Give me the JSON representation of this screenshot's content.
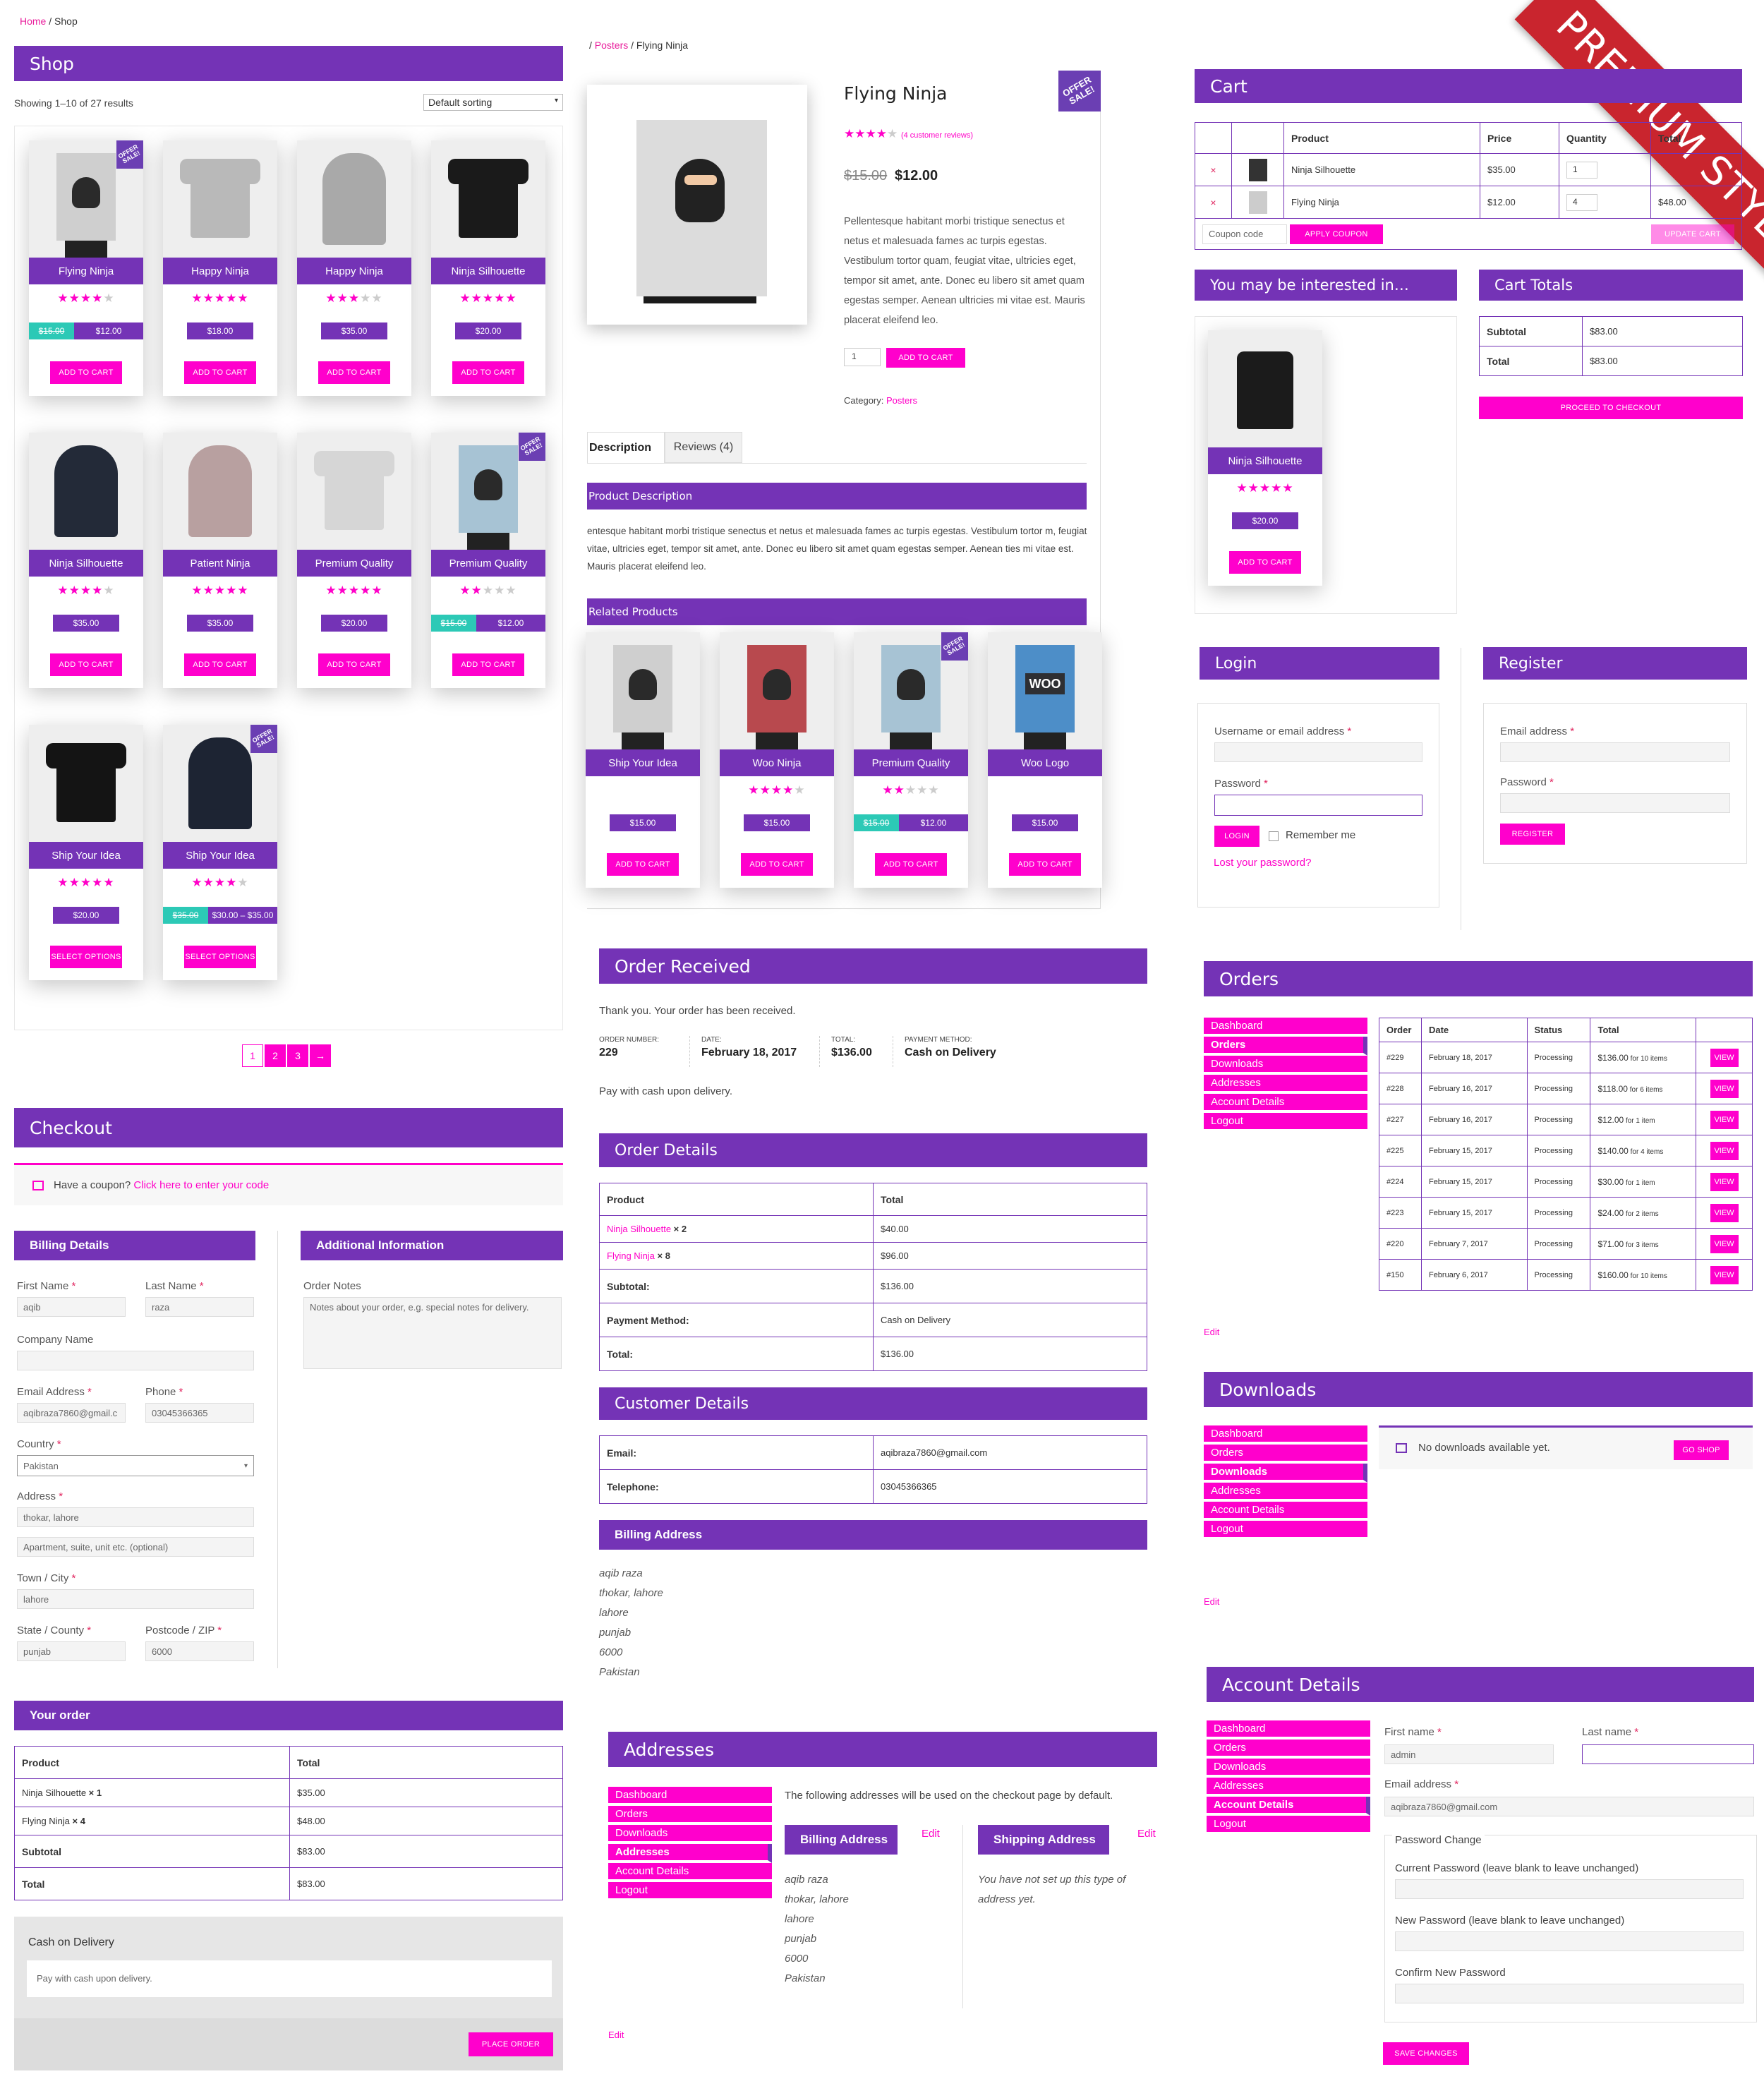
{
  "shop": {
    "breadcrumb": {
      "home": "Home",
      "sep": " / ",
      "current": "Shop"
    },
    "title": "Shop",
    "result_count": "Showing 1–10 of 27 results",
    "sorting": "Default sorting",
    "badge": "OFFER SALE!",
    "products": [
      {
        "name": "Flying Ninja",
        "rating": 4,
        "old_price": "$15.00",
        "price": "$12.00",
        "button": "ADD TO CART",
        "image": "poster-ninja",
        "sale": true
      },
      {
        "name": "Happy Ninja",
        "rating": 5,
        "price": "$18.00",
        "button": "ADD TO CART",
        "image": "tshirt-grey"
      },
      {
        "name": "Happy Ninja",
        "rating": 3,
        "price": "$35.00",
        "button": "ADD TO CART",
        "image": "hoodie-grey"
      },
      {
        "name": "Ninja Silhouette",
        "rating": 5,
        "price": "$20.00",
        "button": "ADD TO CART",
        "image": "tshirt-black"
      },
      {
        "name": "Ninja Silhouette",
        "rating": 4,
        "price": "$35.00",
        "button": "ADD TO CART",
        "image": "hoodie-black"
      },
      {
        "name": "Patient Ninja",
        "rating": 5,
        "price": "$35.00",
        "button": "ADD TO CART",
        "image": "hoodie-pink"
      },
      {
        "name": "Premium Quality",
        "rating": 5,
        "price": "$20.00",
        "button": "ADD TO CART",
        "image": "tshirt-white"
      },
      {
        "name": "Premium Quality",
        "rating": 2,
        "old_price": "$15.00",
        "price": "$12.00",
        "button": "ADD TO CART",
        "image": "poster-blue",
        "sale": true
      },
      {
        "name": "Ship Your Idea",
        "rating": 5,
        "price": "$20.00",
        "button": "SELECT OPTIONS",
        "image": "tshirt-skull"
      },
      {
        "name": "Ship Your Idea",
        "rating": 4,
        "old_price": "$35.00",
        "price": "$30.00 – $35.00",
        "button": "SELECT OPTIONS",
        "image": "hoodie-skull",
        "sale": true
      }
    ],
    "pagination": [
      "1",
      "2",
      "3",
      "→"
    ]
  },
  "product": {
    "breadcrumb": {
      "sep": "/ ",
      "parent": "Posters",
      "current": " / Flying Ninja"
    },
    "title": "Flying Ninja",
    "reviews_link": "(4 customer reviews)",
    "old_price": "$15.00",
    "price": "$12.00",
    "short_desc": "Pellentesque habitant morbi tristique senectus et netus et malesuada fames ac turpis egestas. Vestibulum tortor quam, feugiat vitae, ultricies eget, tempor sit amet, ante. Donec eu libero sit amet quam egestas semper. Aenean ultricies mi vitae est. Mauris placerat eleifend leo.",
    "qty": "1",
    "add_to_cart": "ADD TO CART",
    "category_label": "Category: ",
    "category": "Posters",
    "tab_description": "Description",
    "tab_reviews": "Reviews (4)",
    "desc_heading": "Product Description",
    "desc_text": "entesque habitant morbi tristique senectus et netus et malesuada fames ac turpis egestas. Vestibulum tortor m, feugiat vitae, ultricies eget, tempor sit amet, ante. Donec eu libero sit amet quam egestas semper. Aenean ties mi vitae est. Mauris placerat eleifend leo.",
    "related_heading": "Related Products",
    "related": [
      {
        "name": "Ship Your Idea",
        "price": "$15.00",
        "button": "ADD TO CART",
        "image": "poster-skull"
      },
      {
        "name": "Woo Ninja",
        "rating": 4,
        "price": "$15.00",
        "button": "ADD TO CART",
        "image": "poster-red"
      },
      {
        "name": "Premium Quality",
        "rating": 2,
        "old_price": "$15.00",
        "price": "$12.00",
        "button": "ADD TO CART",
        "image": "poster-blue",
        "sale": true
      },
      {
        "name": "Woo Logo",
        "price": "$15.00",
        "button": "ADD TO CART",
        "image": "poster-woo"
      }
    ]
  },
  "cart": {
    "title": "Cart",
    "cols": [
      "",
      "",
      "Product",
      "Price",
      "Quantity",
      "Total"
    ],
    "rows": [
      {
        "name": "Ninja Silhouette",
        "price": "$35.00",
        "qty": "1",
        "total": ""
      },
      {
        "name": "Flying Ninja",
        "price": "$12.00",
        "qty": "4",
        "total": "$48.00"
      }
    ],
    "coupon_placeholder": "Coupon code",
    "apply": "APPLY COUPON",
    "update": "UPDATE CART",
    "interested": "You may be interested in…",
    "cross": {
      "name": "Ninja Silhouette",
      "rating": 5,
      "price": "$20.00",
      "button": "ADD TO CART"
    },
    "totals_title": "Cart Totals",
    "subtotal_label": "Subtotal",
    "subtotal": "$83.00",
    "total_label": "Total",
    "total": "$83.00",
    "checkout": "PROCEED TO CHECKOUT"
  },
  "premium": "PREMIUM STYLE",
  "login": {
    "title": "Login",
    "user_label": "Username or email address",
    "pass_label": "Password",
    "button": "LOGIN",
    "remember": "Remember me",
    "lost": "Lost your password?"
  },
  "register": {
    "title": "Register",
    "email_label": "Email address",
    "pass_label": "Password",
    "button": "REGISTER"
  },
  "checkout": {
    "title": "Checkout",
    "coupon_text": "Have a coupon?",
    "coupon_link": "Click here to enter your code",
    "billing": "Billing Details",
    "additional": "Additional Information",
    "first_name": "First Name",
    "first_val": "aqib",
    "last_name": "Last Name",
    "last_val": "raza",
    "company": "Company Name",
    "email": "Email Address",
    "email_val": "aqibraza7860@gmail.c",
    "phone": "Phone",
    "phone_val": "03045366365",
    "country": "Country",
    "country_val": "Pakistan",
    "address": "Address",
    "address_val": "thokar, lahore",
    "address2": "Apartment, suite, unit etc. (optional)",
    "town": "Town / City",
    "town_val": "lahore",
    "state": "State / County",
    "state_val": "punjab",
    "postcode": "Postcode / ZIP",
    "postcode_val": "6000",
    "notes_label": "Order Notes",
    "notes_placeholder": "Notes about your order, e.g. special notes for delivery.",
    "your_order": "Your order",
    "cols": [
      "Product",
      "Total"
    ],
    "rows": [
      {
        "name": "Ninja Silhouette",
        "qty": " × 1",
        "total": "$35.00"
      },
      {
        "name": "Flying Ninja",
        "qty": " × 4",
        "total": "$48.00"
      }
    ],
    "subtotal_label": "Subtotal",
    "subtotal": "$83.00",
    "total_label": "Total",
    "total": "$83.00",
    "payment": "Cash on Delivery",
    "payment_note": "Pay with cash upon delivery.",
    "place": "PLACE ORDER"
  },
  "order": {
    "title": "Order Received",
    "thanks": "Thank you. Your order has been received.",
    "meta": [
      {
        "k": "ORDER NUMBER:",
        "v": "229"
      },
      {
        "k": "DATE:",
        "v": "February 18, 2017"
      },
      {
        "k": "TOTAL:",
        "v": "$136.00"
      },
      {
        "k": "PAYMENT METHOD:",
        "v": "Cash on Delivery"
      }
    ],
    "pay_note": "Pay with cash upon delivery.",
    "details_title": "Order Details",
    "cols": [
      "Product",
      "Total"
    ],
    "items": [
      {
        "name": "Ninja Silhouette",
        "qty": " × 2",
        "total": "$40.00"
      },
      {
        "name": "Flying Ninja",
        "qty": " × 8",
        "total": "$96.00"
      }
    ],
    "summary": [
      {
        "k": "Subtotal:",
        "v": "$136.00"
      },
      {
        "k": "Payment Method:",
        "v": "Cash on Delivery"
      },
      {
        "k": "Total:",
        "v": "$136.00"
      }
    ],
    "customer_title": "Customer Details",
    "customer": [
      {
        "k": "Email:",
        "v": "aqibraza7860@gmail.com"
      },
      {
        "k": "Telephone:",
        "v": "03045366365"
      }
    ],
    "billing_title": "Billing Address",
    "billing_lines": [
      "aqib raza",
      "thokar, lahore",
      "lahore",
      "punjab",
      "6000",
      "Pakistan"
    ]
  },
  "account_nav": [
    "Dashboard",
    "Orders",
    "Downloads",
    "Addresses",
    "Account Details",
    "Logout"
  ],
  "orders": {
    "title": "Orders",
    "cols": [
      "Order",
      "Date",
      "Status",
      "Total",
      ""
    ],
    "rows": [
      {
        "id": "#229",
        "date": "February 18, 2017",
        "status": "Processing",
        "total": "$136.00",
        "items": " for 10 items"
      },
      {
        "id": "#228",
        "date": "February 16, 2017",
        "status": "Processing",
        "total": "$118.00",
        "items": " for 6 items"
      },
      {
        "id": "#227",
        "date": "February 16, 2017",
        "status": "Processing",
        "total": "$12.00",
        "items": " for 1 item"
      },
      {
        "id": "#225",
        "date": "February 15, 2017",
        "status": "Processing",
        "total": "$140.00",
        "items": " for 4 items"
      },
      {
        "id": "#224",
        "date": "February 15, 2017",
        "status": "Processing",
        "total": "$30.00",
        "items": " for 1 item"
      },
      {
        "id": "#223",
        "date": "February 15, 2017",
        "status": "Processing",
        "total": "$24.00",
        "items": " for 2 items"
      },
      {
        "id": "#220",
        "date": "February 7, 2017",
        "status": "Processing",
        "total": "$71.00",
        "items": " for 3 items"
      },
      {
        "id": "#150",
        "date": "February 6, 2017",
        "status": "Processing",
        "total": "$160.00",
        "items": " for 10 items"
      }
    ],
    "view": "VIEW",
    "edit": "Edit"
  },
  "downloads": {
    "title": "Downloads",
    "empty": "No downloads available yet.",
    "go": "GO SHOP",
    "edit": "Edit"
  },
  "addresses": {
    "title": "Addresses",
    "intro": "The following addresses will be used on the checkout page by default.",
    "billing": "Billing Address",
    "shipping": "Shipping Address",
    "edit": "Edit",
    "billing_lines": [
      "aqib raza",
      "thokar, lahore",
      "lahore",
      "punjab",
      "6000",
      "Pakistan"
    ],
    "shipping_text": "You have not set up this type of address yet.",
    "bottom_edit": "Edit"
  },
  "account": {
    "title": "Account Details",
    "first": "First name",
    "first_val": "admin",
    "last": "Last name",
    "email": "Email address",
    "email_val": "aqibraza7860@gmail.com",
    "pw_legend": "Password Change",
    "cur": "Current Password (leave blank to leave unchanged)",
    "new": "New Password (leave blank to leave unchanged)",
    "confirm": "Confirm New Password",
    "save": "SAVE CHANGES"
  }
}
